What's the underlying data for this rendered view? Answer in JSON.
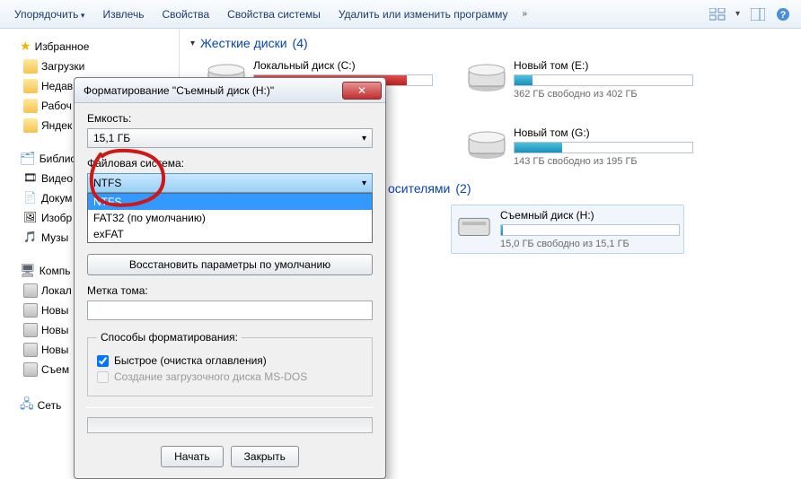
{
  "toolbar": {
    "organize": "Упорядочить",
    "extract": "Извлечь",
    "properties": "Свойства",
    "sysprops": "Свойства системы",
    "uninstall": "Удалить или изменить программу"
  },
  "sidebar": {
    "favorites": {
      "label": "Избранное",
      "items": [
        "Загрузки",
        "Недав",
        "Рабоч",
        "Яндек"
      ]
    },
    "libraries": {
      "label": "Библио",
      "items": [
        "Видео",
        "Докум",
        "Изобр",
        "Музы"
      ]
    },
    "computer": {
      "label": "Компь",
      "items": [
        "Локал",
        "Новы",
        "Новы",
        "Новы",
        "Съем"
      ]
    },
    "network": {
      "label": "Сеть"
    }
  },
  "sections": {
    "hdd": {
      "label": "Жесткие диски",
      "count": "(4)"
    },
    "removable": {
      "label": "осителями",
      "count": "(2)"
    }
  },
  "drives": [
    {
      "name": "Локальный диск (C:)",
      "free": "",
      "fillPct": 86,
      "color": "red"
    },
    {
      "name": "Новый том (E:)",
      "free": "362 ГБ свободно из 402 ГБ",
      "fillPct": 10,
      "color": "blue"
    },
    {
      "name": "",
      "free": ""
    },
    {
      "name": "Новый том (G:)",
      "free": "143 ГБ свободно из 195 ГБ",
      "fillPct": 27,
      "color": "blue"
    }
  ],
  "removable": {
    "name": "Съемный диск (H:)",
    "free": "15,0 ГБ свободно из 15,1 ГБ",
    "fillPct": 1
  },
  "dialog": {
    "title": "Форматирование \"Съемный диск (H:)\"",
    "capacity_label": "Емкость:",
    "capacity_value": "15,1 ГБ",
    "fs_label": "Файловая система:",
    "fs_value": "NTFS",
    "fs_options": [
      "NTFS",
      "FAT32 (по умолчанию)",
      "exFAT"
    ],
    "alloc_label": "",
    "restore_btn": "Восстановить параметры по умолчанию",
    "volume_label": "Метка тома:",
    "methods_label": "Способы форматирования:",
    "quick": "Быстрое (очистка оглавления)",
    "msdos": "Создание загрузочного диска MS-DOS",
    "start_btn": "Начать",
    "close_btn": "Закрыть"
  }
}
